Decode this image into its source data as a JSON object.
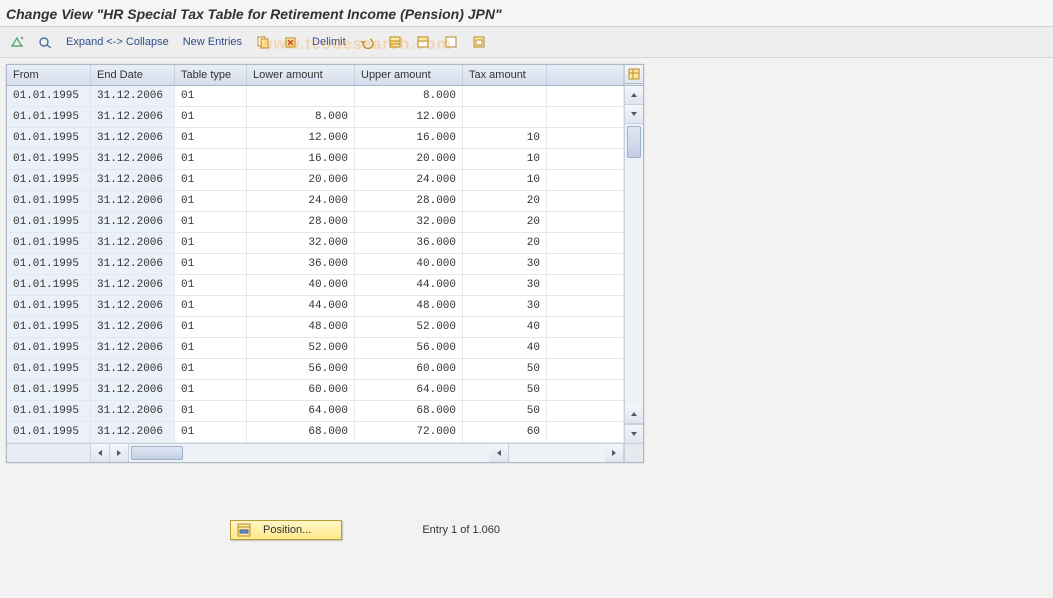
{
  "title": "Change View \"HR Special Tax Table for Retirement Income (Pension) JPN\"",
  "watermark": "www.tcodesearch.com",
  "toolbar": {
    "expand": "Expand <-> Collapse",
    "new_entries": "New Entries",
    "delimit": "Delimit"
  },
  "columns": {
    "from": "From",
    "end": "End Date",
    "type": "Table type",
    "lower": "Lower amount",
    "upper": "Upper amount",
    "tax": "Tax amount"
  },
  "rows": [
    {
      "from": "01.01.1995",
      "end": "31.12.2006",
      "type": "01",
      "lower": "",
      "upper": "8.000",
      "tax": ""
    },
    {
      "from": "01.01.1995",
      "end": "31.12.2006",
      "type": "01",
      "lower": "8.000",
      "upper": "12.000",
      "tax": ""
    },
    {
      "from": "01.01.1995",
      "end": "31.12.2006",
      "type": "01",
      "lower": "12.000",
      "upper": "16.000",
      "tax": "10"
    },
    {
      "from": "01.01.1995",
      "end": "31.12.2006",
      "type": "01",
      "lower": "16.000",
      "upper": "20.000",
      "tax": "10"
    },
    {
      "from": "01.01.1995",
      "end": "31.12.2006",
      "type": "01",
      "lower": "20.000",
      "upper": "24.000",
      "tax": "10"
    },
    {
      "from": "01.01.1995",
      "end": "31.12.2006",
      "type": "01",
      "lower": "24.000",
      "upper": "28.000",
      "tax": "20"
    },
    {
      "from": "01.01.1995",
      "end": "31.12.2006",
      "type": "01",
      "lower": "28.000",
      "upper": "32.000",
      "tax": "20"
    },
    {
      "from": "01.01.1995",
      "end": "31.12.2006",
      "type": "01",
      "lower": "32.000",
      "upper": "36.000",
      "tax": "20"
    },
    {
      "from": "01.01.1995",
      "end": "31.12.2006",
      "type": "01",
      "lower": "36.000",
      "upper": "40.000",
      "tax": "30"
    },
    {
      "from": "01.01.1995",
      "end": "31.12.2006",
      "type": "01",
      "lower": "40.000",
      "upper": "44.000",
      "tax": "30"
    },
    {
      "from": "01.01.1995",
      "end": "31.12.2006",
      "type": "01",
      "lower": "44.000",
      "upper": "48.000",
      "tax": "30"
    },
    {
      "from": "01.01.1995",
      "end": "31.12.2006",
      "type": "01",
      "lower": "48.000",
      "upper": "52.000",
      "tax": "40"
    },
    {
      "from": "01.01.1995",
      "end": "31.12.2006",
      "type": "01",
      "lower": "52.000",
      "upper": "56.000",
      "tax": "40"
    },
    {
      "from": "01.01.1995",
      "end": "31.12.2006",
      "type": "01",
      "lower": "56.000",
      "upper": "60.000",
      "tax": "50"
    },
    {
      "from": "01.01.1995",
      "end": "31.12.2006",
      "type": "01",
      "lower": "60.000",
      "upper": "64.000",
      "tax": "50"
    },
    {
      "from": "01.01.1995",
      "end": "31.12.2006",
      "type": "01",
      "lower": "64.000",
      "upper": "68.000",
      "tax": "50"
    },
    {
      "from": "01.01.1995",
      "end": "31.12.2006",
      "type": "01",
      "lower": "68.000",
      "upper": "72.000",
      "tax": "60"
    }
  ],
  "footer": {
    "position_label": "Position...",
    "entry_text": "Entry 1 of 1.060"
  }
}
